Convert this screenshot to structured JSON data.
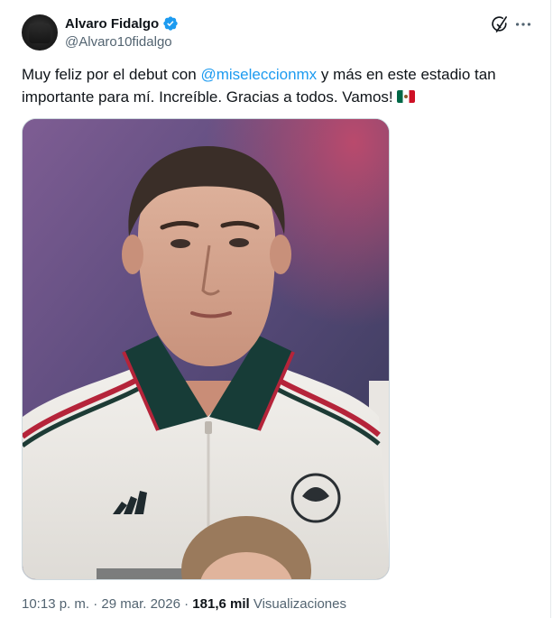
{
  "author": {
    "name": "Alvaro Fidalgo",
    "handle": "@Alvaro10fidalgo",
    "verified": true,
    "verified_color": "#1d9bf0"
  },
  "actions": {
    "grok_icon": "grok-icon",
    "more_icon": "more-icon"
  },
  "tweet": {
    "text_before": "Muy feliz por el debut con ",
    "mention": "@mi​seleccionmx",
    "text_after": " y más en este estadio tan importante para mí. Increíble. Gracias a todos. Vamos!",
    "flag_emoji": "mexico-flag"
  },
  "meta": {
    "time": "10:13 p. m.",
    "separator": " · ",
    "date": "29 mar. 2026",
    "views_count": "181,6 mil",
    "views_label": " Visualizaciones"
  },
  "colors": {
    "text": "#0f1419",
    "secondary": "#536471",
    "accent": "#1d9bf0"
  }
}
